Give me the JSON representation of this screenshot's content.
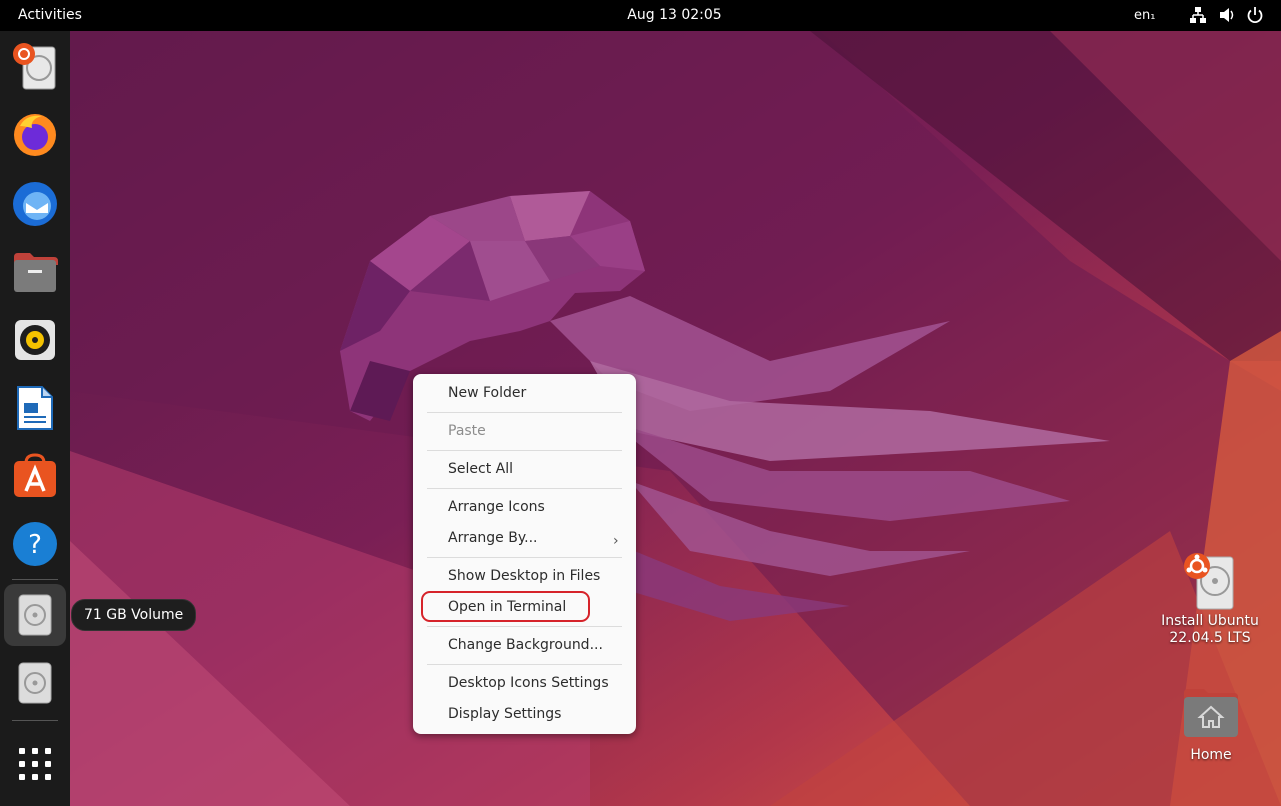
{
  "topbar": {
    "activities": "Activities",
    "datetime": "Aug 13  02:05",
    "language": "en₁",
    "tray_icons": [
      "network-icon",
      "volume-icon",
      "power-icon"
    ]
  },
  "dock": {
    "items": [
      "install-ubuntu",
      "firefox",
      "thunderbird",
      "files",
      "rhythmbox",
      "libreoffice-writer",
      "ubuntu-software",
      "help",
      "drive-71gb",
      "drive-2",
      "show-apps"
    ]
  },
  "tooltip": {
    "text": "71 GB Volume"
  },
  "context_menu": {
    "items": {
      "new_folder": "New Folder",
      "paste": "Paste",
      "select_all": "Select All",
      "arrange_icons": "Arrange Icons",
      "arrange_by": "Arrange By...",
      "show_desktop_in_files": "Show Desktop in Files",
      "open_in_terminal": "Open in Terminal",
      "change_background": "Change Background...",
      "desktop_icons_settings": "Desktop Icons Settings",
      "display_settings": "Display Settings"
    },
    "highlighted_item": "Open in Terminal",
    "highlight_color": "#d6232a"
  },
  "desktop_icons": {
    "install": {
      "line1": "Install Ubuntu",
      "line2": "22.04.5 LTS"
    },
    "home": {
      "label": "Home"
    }
  },
  "colors": {
    "accent": "#e95420",
    "wallpaper_purple": "#6d1f52",
    "wallpaper_orange": "#d2533a"
  }
}
